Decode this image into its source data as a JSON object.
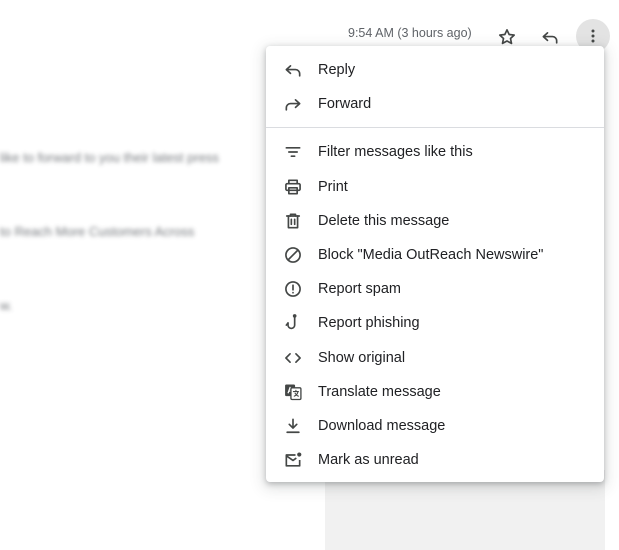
{
  "header": {
    "timestamp": "9:54 AM (3 hours ago)"
  },
  "email_body": {
    "line1": "like to forward to you their latest press",
    "line2": "to Reach More Customers Across",
    "line3": "w."
  },
  "menu": {
    "reply": "Reply",
    "forward": "Forward",
    "filter": "Filter messages like this",
    "print": "Print",
    "delete": "Delete this message",
    "block": "Block \"Media OutReach Newswire\"",
    "report_spam": "Report spam",
    "report_phishing": "Report phishing",
    "show_original": "Show original",
    "translate": "Translate message",
    "download": "Download message",
    "mark_unread": "Mark as unread"
  },
  "colors": {
    "icon": "#444746",
    "text": "#202124",
    "muted": "#5f6368",
    "divider": "#dadce0",
    "more_button_bg": "#e3e3e3"
  }
}
